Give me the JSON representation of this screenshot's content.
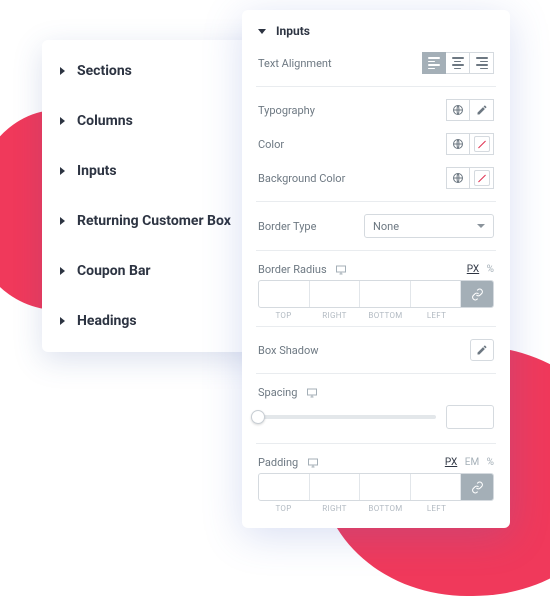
{
  "accordion": {
    "items": [
      {
        "label": "Sections"
      },
      {
        "label": "Columns"
      },
      {
        "label": "Inputs"
      },
      {
        "label": "Returning Customer Box"
      },
      {
        "label": "Coupon Bar"
      },
      {
        "label": "Headings"
      }
    ]
  },
  "panel": {
    "title": "Inputs",
    "text_alignment_label": "Text Alignment",
    "typography_label": "Typography",
    "color_label": "Color",
    "bg_color_label": "Background Color",
    "border_type_label": "Border Type",
    "border_type_value": "None",
    "border_radius_label": "Border Radius",
    "unit_px": "PX",
    "unit_pct": "%",
    "unit_em": "EM",
    "sides": {
      "top": "TOP",
      "right": "RIGHT",
      "bottom": "BOTTOM",
      "left": "LEFT"
    },
    "box_shadow_label": "Box Shadow",
    "spacing_label": "Spacing",
    "padding_label": "Padding"
  }
}
